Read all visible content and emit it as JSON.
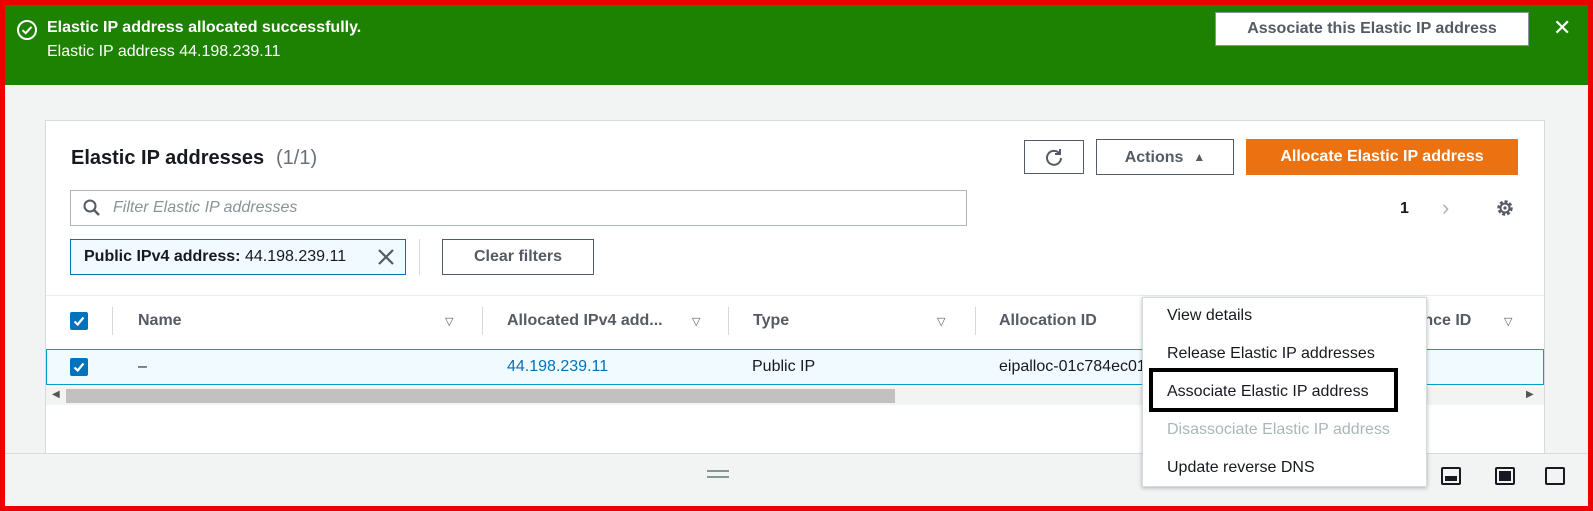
{
  "banner": {
    "title": "Elastic IP address allocated successfully.",
    "subtitle": "Elastic IP address 44.198.239.11",
    "action_label": "Associate this Elastic IP address",
    "close_glyph": "✕",
    "color": "#1d8102"
  },
  "panel": {
    "title": "Elastic IP addresses",
    "count": "(1/1)",
    "actions_label": "Actions",
    "allocate_label": "Allocate Elastic IP address",
    "search_placeholder": "Filter Elastic IP addresses",
    "filter_token_key": "Public IPv4 address:",
    "filter_token_value": "44.198.239.11",
    "clear_filters_label": "Clear filters",
    "page_number": "1"
  },
  "table": {
    "columns": [
      "Name",
      "Allocated IPv4 add...",
      "Type",
      "Allocation ID",
      "instance ID"
    ],
    "row": {
      "name": "–",
      "ip": "44.198.239.11",
      "type": "Public IP",
      "allocation_id": "eipalloc-01c784ec01b292a7e"
    }
  },
  "actions_menu": {
    "items": [
      {
        "label": "View details",
        "disabled": false
      },
      {
        "label": "Release Elastic IP addresses",
        "disabled": false
      },
      {
        "label": "Associate Elastic IP address",
        "disabled": false,
        "highlighted": true
      },
      {
        "label": "Disassociate Elastic IP address",
        "disabled": true
      },
      {
        "label": "Update reverse DNS",
        "disabled": false
      }
    ]
  },
  "colors": {
    "accent_orange": "#ec7211",
    "link_blue": "#0073bb",
    "annotation_red": "#ee0000"
  }
}
